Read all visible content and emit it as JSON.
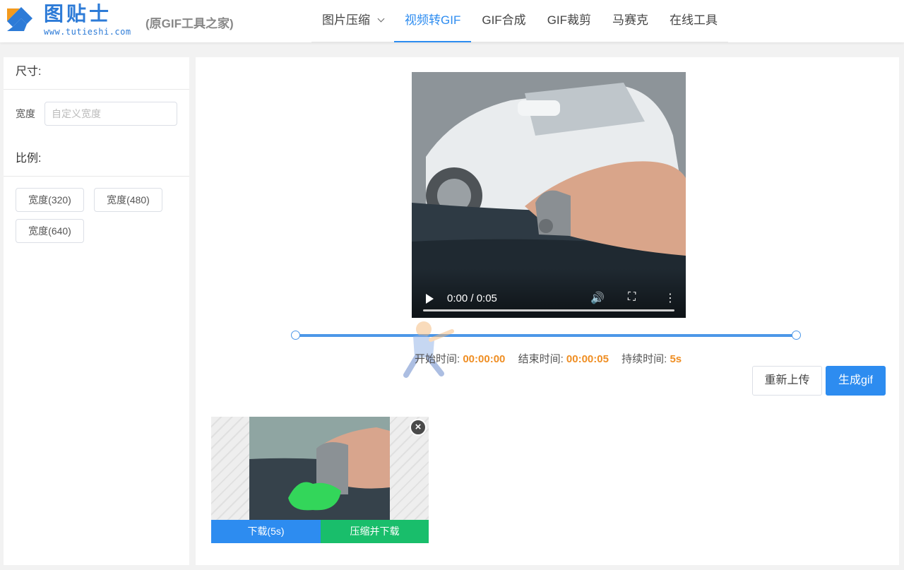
{
  "header": {
    "brand_name": "图贴士",
    "brand_url": "www.tutieshi.com",
    "brand_subtitle": "(原GIF工具之家)",
    "nav": [
      {
        "label": "图片压缩",
        "has_dropdown": true
      },
      {
        "label": "视频转GIF",
        "active": true
      },
      {
        "label": "GIF合成"
      },
      {
        "label": "GIF裁剪"
      },
      {
        "label": "马赛克"
      },
      {
        "label": "在线工具"
      }
    ]
  },
  "sidebar": {
    "size_title": "尺寸:",
    "width_label": "宽度",
    "width_placeholder": "自定义宽度",
    "ratio_title": "比例:",
    "ratio_buttons": [
      "宽度(320)",
      "宽度(480)",
      "宽度(640)"
    ]
  },
  "video": {
    "time": "0:00 / 0:05",
    "progress": 0
  },
  "range": {
    "start_fraction": 0,
    "end_fraction": 1
  },
  "timeinfo": {
    "start_label": "开始时间:",
    "start_value": "00:00:00",
    "end_label": "结束时间:",
    "end_value": "00:00:05",
    "duration_label": "持续时间:",
    "duration_value": "5s"
  },
  "actions": {
    "reupload": "重新上传",
    "generate": "生成gif"
  },
  "result": {
    "close": "×",
    "download": "下载(5s)",
    "compress_download": "压缩并下载"
  },
  "colors": {
    "primary": "#2d8cf0",
    "success": "#19be6b",
    "accent_orange": "#ef8e23"
  }
}
